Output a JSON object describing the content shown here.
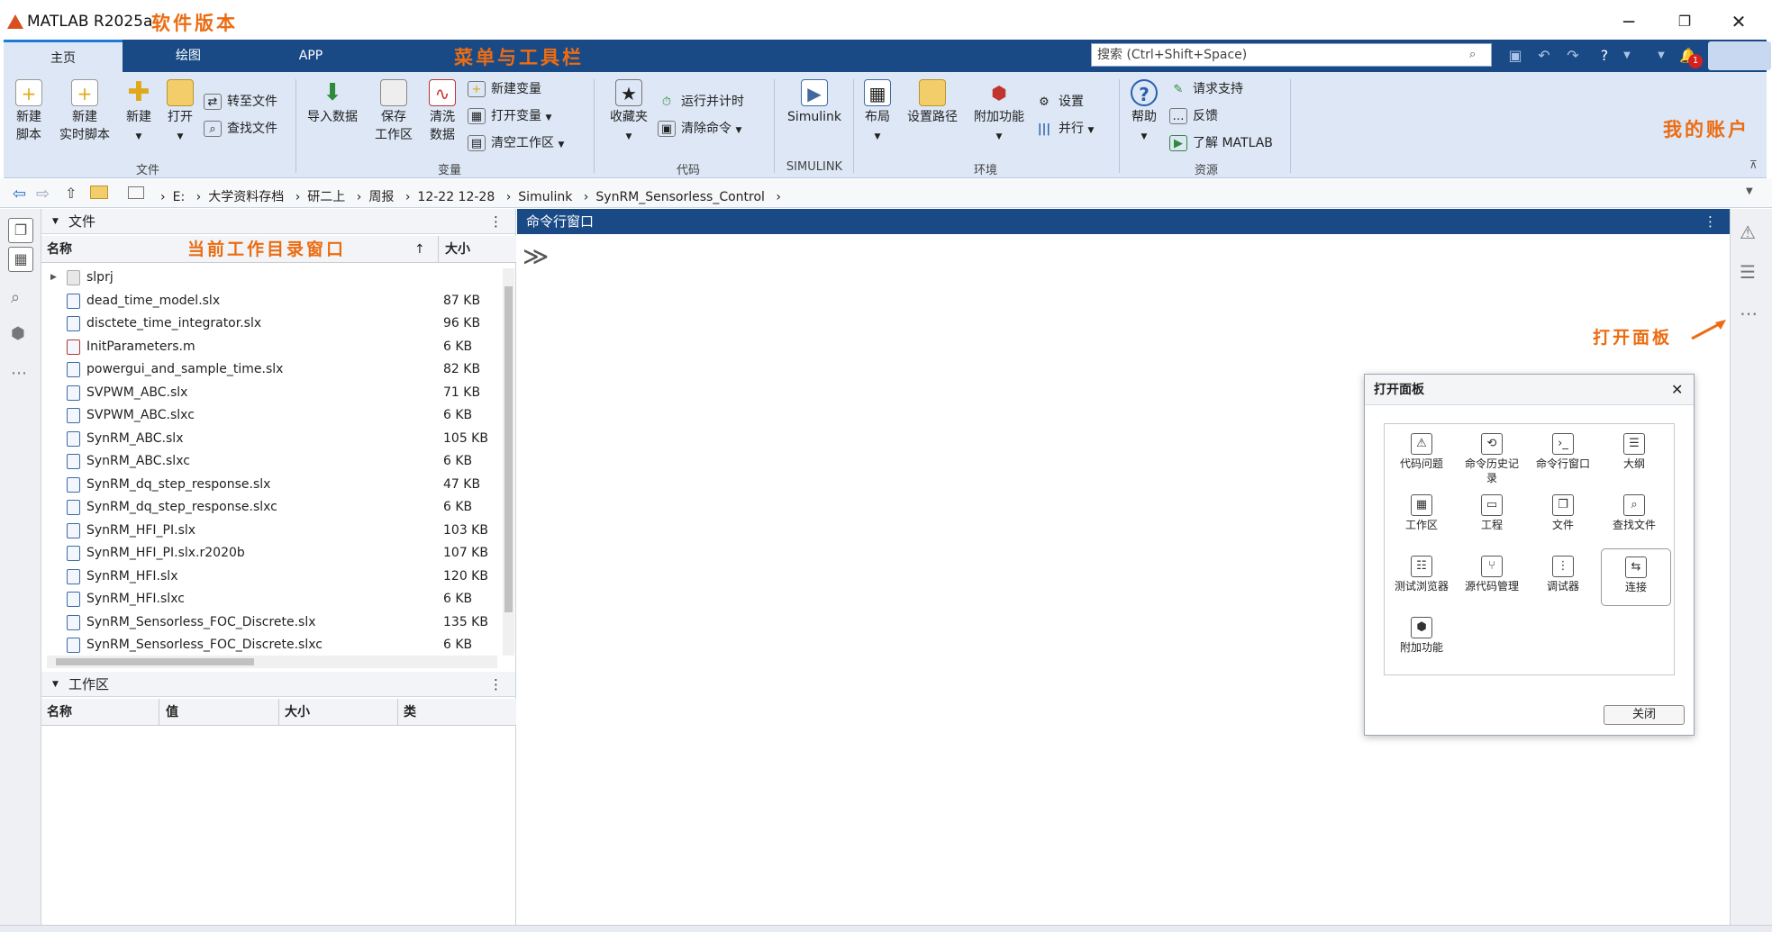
{
  "titlebar": {
    "title": "MATLAB R2025a",
    "note": "软件版本",
    "minimize": "─",
    "maximize": "❐",
    "close": "✕"
  },
  "tabs": [
    {
      "label": "主页"
    },
    {
      "label": "绘图"
    },
    {
      "label": "APP"
    }
  ],
  "menu_note": "菜单与工具栏",
  "search": {
    "placeholder": "搜索 (Ctrl+Shift+Space)"
  },
  "account_note": "我的账户",
  "ribbon": {
    "file": {
      "new_script": "新建\n脚本",
      "new_live": "新建\n实时脚本",
      "new": "新建",
      "open": "打开",
      "goto_file": "转至文件",
      "find_file": "查找文件",
      "group": "文件"
    },
    "variable": {
      "import": "导入数据",
      "save_ws": "保存\n工作区",
      "clean": "清洗\n数据",
      "new_var": "新建变量",
      "open_var": "打开变量",
      "clear_ws": "清空工作区",
      "group": "变量"
    },
    "code": {
      "favorites": "收藏夹",
      "run_time": "运行并计时",
      "clear_cmd": "清除命令",
      "group": "代码"
    },
    "simulink": {
      "simulink": "Simulink",
      "group": "SIMULINK"
    },
    "env": {
      "layout": "布局",
      "set_path": "设置路径",
      "addons": "附加功能",
      "settings": "设置",
      "parallel": "并行",
      "group": "环境"
    },
    "resources": {
      "help": "帮助",
      "support": "请求支持",
      "feedback": "反馈",
      "learn": "了解 MATLAB",
      "group": "资源"
    }
  },
  "breadcrumb": [
    "E:",
    "大学资料存档",
    "研二上",
    "周报",
    "12-22 12-28",
    "Simulink",
    "SynRM_Sensorless_Control"
  ],
  "file_panel": {
    "title": "文件",
    "note": "当前工作目录窗口",
    "col_name": "名称",
    "col_size": "大小",
    "files": [
      {
        "name": "slprj",
        "size": "",
        "type": "folder"
      },
      {
        "name": "dead_time_model.slx",
        "size": "87 KB",
        "type": "slx"
      },
      {
        "name": "disctete_time_integrator.slx",
        "size": "96 KB",
        "type": "slx"
      },
      {
        "name": "InitParameters.m",
        "size": "6 KB",
        "type": "m"
      },
      {
        "name": "powergui_and_sample_time.slx",
        "size": "82 KB",
        "type": "slx"
      },
      {
        "name": "SVPWM_ABC.slx",
        "size": "71 KB",
        "type": "slx"
      },
      {
        "name": "SVPWM_ABC.slxc",
        "size": "6 KB",
        "type": "slxc"
      },
      {
        "name": "SynRM_ABC.slx",
        "size": "105 KB",
        "type": "slx"
      },
      {
        "name": "SynRM_ABC.slxc",
        "size": "6 KB",
        "type": "slxc"
      },
      {
        "name": "SynRM_dq_step_response.slx",
        "size": "47 KB",
        "type": "slx"
      },
      {
        "name": "SynRM_dq_step_response.slxc",
        "size": "6 KB",
        "type": "slxc"
      },
      {
        "name": "SynRM_HFI_PI.slx",
        "size": "103 KB",
        "type": "slx"
      },
      {
        "name": "SynRM_HFI_PI.slx.r2020b",
        "size": "107 KB",
        "type": "slx"
      },
      {
        "name": "SynRM_HFI.slx",
        "size": "120 KB",
        "type": "slx"
      },
      {
        "name": "SynRM_HFI.slxc",
        "size": "6 KB",
        "type": "slxc"
      },
      {
        "name": "SynRM_Sensorless_FOC_Discrete.slx",
        "size": "135 KB",
        "type": "slx"
      },
      {
        "name": "SynRM_Sensorless_FOC_Discrete.slxc",
        "size": "6 KB",
        "type": "slxc"
      }
    ]
  },
  "workspace": {
    "title": "工作区",
    "cols": [
      "名称",
      "值",
      "大小",
      "类"
    ]
  },
  "command": {
    "title": "命令行窗口",
    "prompt": "≫"
  },
  "panel_note": "打开面板",
  "dialog": {
    "title": "打开面板",
    "close_label": "关闭",
    "items": [
      "代码问题",
      "命令历史记录",
      "命令行窗口",
      "大纲",
      "工作区",
      "工程",
      "文件",
      "查找文件",
      "测试浏览器",
      "源代码管理",
      "调试器",
      "连接",
      "附加功能"
    ]
  },
  "colors": {
    "accent": "#194a86",
    "ribbon": "#dde7f5",
    "note": "#ec6c12"
  }
}
